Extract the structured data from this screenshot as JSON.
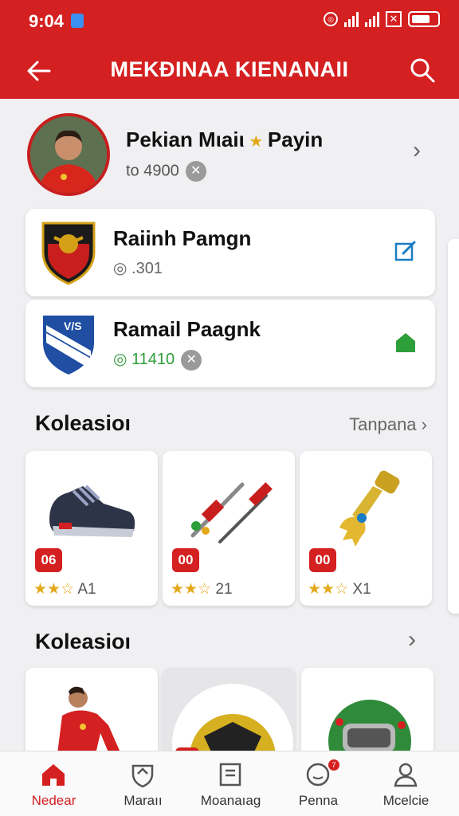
{
  "status": {
    "time": "9:04"
  },
  "header": {
    "title": "MEKÐINAA KIENANAII"
  },
  "profile": {
    "name": "Pekian Mιaiι",
    "name_suffix": "Payin",
    "score": "to 4900"
  },
  "teams": [
    {
      "name": "Raiinh Pamgn",
      "value": "◎ .301"
    },
    {
      "name": "Ramail Paagnk",
      "value": "◎ 11410"
    }
  ],
  "sections": [
    {
      "title": "Koleasioı",
      "more": "Tanpana"
    },
    {
      "title": "Koleasioı"
    }
  ],
  "items": [
    {
      "badge": "06",
      "stars": "★★☆",
      "rating": "A1"
    },
    {
      "badge": "00",
      "stars": "★★☆",
      "rating": "21"
    },
    {
      "badge": "00",
      "stars": "★★☆",
      "rating": "X1"
    }
  ],
  "nav": [
    {
      "label": "Nedear"
    },
    {
      "label": "Maraıı"
    },
    {
      "label": "Moanaıag"
    },
    {
      "label": "Penna",
      "badge": "7"
    },
    {
      "label": "Mcelcie"
    }
  ],
  "colors": {
    "primary": "#d42020",
    "star": "#e3a91c",
    "green": "#2e9e3a",
    "blue": "#1a7dc4"
  },
  "icons": [
    "back-arrow-icon",
    "search-icon",
    "star-icon",
    "chevron-right-icon",
    "edit-icon",
    "home-icon"
  ]
}
